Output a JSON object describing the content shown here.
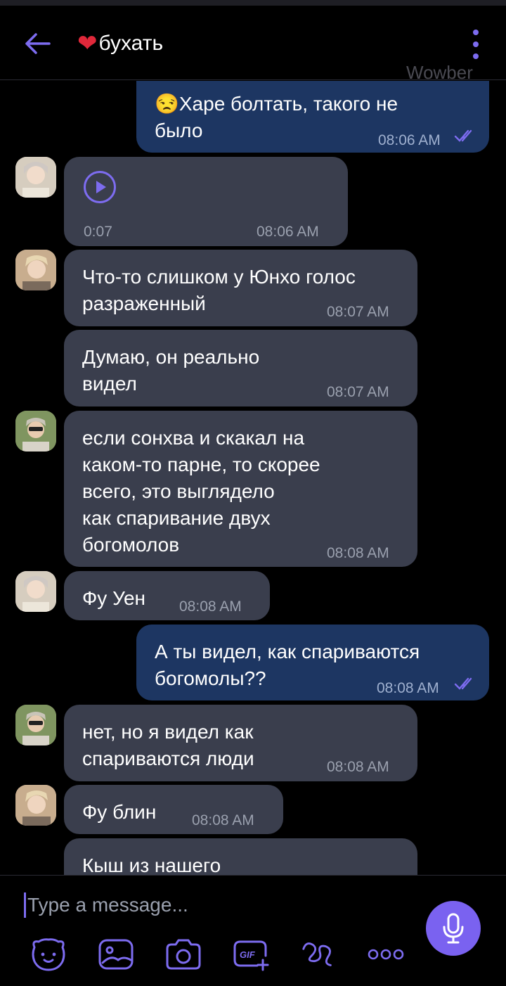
{
  "app": {
    "chat_title": "бухать",
    "title_icon": "heart-emoji",
    "watermark": "Wowber",
    "accent": "#7d6cf0",
    "incoming_bubble": "#3a3e4d",
    "outgoing_bubble": "#1d3662"
  },
  "messages": [
    {
      "direction": "out",
      "emoji": "😒",
      "text": "Харе болтать, такого не\nбыло",
      "time": "08:06 AM",
      "status": "read"
    },
    {
      "direction": "in",
      "type": "voice",
      "duration": "0:07",
      "time": "08:06 AM"
    },
    {
      "direction": "in",
      "text": "Что-то слишком у Юнхо голос\nразраженный",
      "time": "08:07 AM"
    },
    {
      "direction": "in",
      "text": "Думаю, он реально\nвидел",
      "time": "08:07 AM"
    },
    {
      "direction": "in",
      "text": "если сонхва и скакал на\nкаком-то парне, то скорее\nвсего, это выглядело\nкак спаривание двух\nбогомолов",
      "time": "08:08 AM"
    },
    {
      "direction": "in",
      "text": "Фу Уен",
      "time": "08:08 AM"
    },
    {
      "direction": "out",
      "text": "А ты видел, как спариваются\nбогомолы??",
      "time": "08:08 AM",
      "status": "read"
    },
    {
      "direction": "in",
      "text": "нет, но я видел как\nспариваются люди",
      "time": "08:08 AM"
    },
    {
      "direction": "in",
      "text": "Фу блин",
      "time": "08:08 AM"
    },
    {
      "direction": "in",
      "text": "Кыш из нашего",
      "time": ""
    }
  ],
  "composer": {
    "placeholder": "Type a message...",
    "toolbar": [
      "sticker-icon",
      "gallery-icon",
      "camera-icon",
      "gif-icon",
      "doodle-icon",
      "more-options-icon"
    ]
  }
}
